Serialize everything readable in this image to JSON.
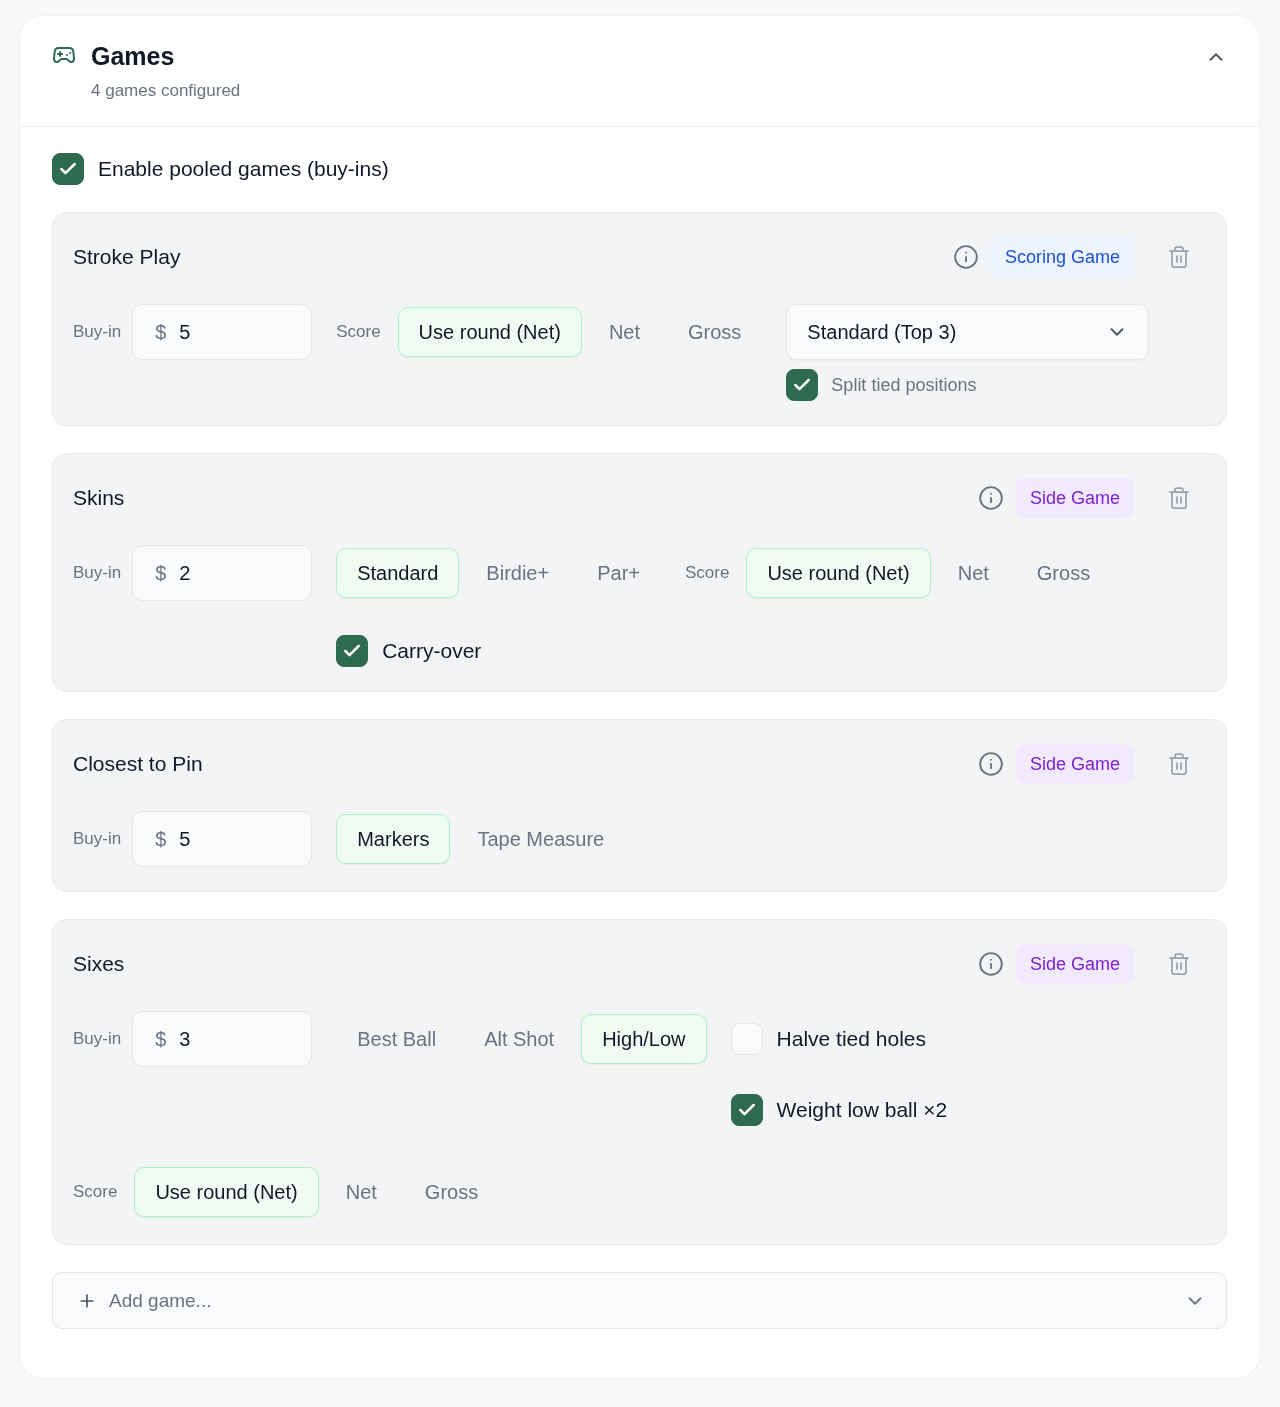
{
  "panel": {
    "title": "Games",
    "subtitle": "4 games configured",
    "expanded": true
  },
  "pooled": {
    "label": "Enable pooled games (buy-ins)",
    "checked": true
  },
  "games": [
    {
      "name": "Stroke Play",
      "tag": {
        "kind": "scoring",
        "label": "Scoring Game"
      },
      "controls": [
        {
          "kind": "buyin",
          "label": "Buy-in",
          "currency": "$",
          "value": "5"
        },
        {
          "kind": "choice",
          "label": "Score",
          "options": [
            {
              "label": "Use round (Net)",
              "selected": true
            },
            {
              "label": "Net",
              "selected": false
            },
            {
              "label": "Gross",
              "selected": false
            }
          ]
        },
        {
          "kind": "select",
          "value": "Standard (Top 3)",
          "option": {
            "label": "Split tied positions",
            "checked": true
          }
        }
      ]
    },
    {
      "name": "Skins",
      "tag": {
        "kind": "side",
        "label": "Side Game"
      },
      "controls": [
        {
          "kind": "buyin",
          "label": "Buy-in",
          "currency": "$",
          "value": "2"
        },
        {
          "kind": "choice",
          "options": [
            {
              "label": "Standard",
              "selected": true
            },
            {
              "label": "Birdie+",
              "selected": false
            },
            {
              "label": "Par+",
              "selected": false
            }
          ],
          "checkboxes": [
            {
              "label": "Carry-over",
              "checked": true
            }
          ]
        },
        {
          "kind": "choice",
          "label": "Score",
          "options": [
            {
              "label": "Use round (Net)",
              "selected": true
            },
            {
              "label": "Net",
              "selected": false
            },
            {
              "label": "Gross",
              "selected": false
            }
          ]
        }
      ]
    },
    {
      "name": "Closest to Pin",
      "tag": {
        "kind": "side",
        "label": "Side Game"
      },
      "controls": [
        {
          "kind": "buyin",
          "label": "Buy-in",
          "currency": "$",
          "value": "5"
        },
        {
          "kind": "choice",
          "options": [
            {
              "label": "Markers",
              "selected": true
            },
            {
              "label": "Tape Measure",
              "selected": false
            }
          ]
        }
      ]
    },
    {
      "name": "Sixes",
      "tag": {
        "kind": "side",
        "label": "Side Game"
      },
      "controls": [
        {
          "kind": "buyin",
          "label": "Buy-in",
          "currency": "$",
          "value": "3"
        },
        {
          "kind": "choice",
          "options": [
            {
              "label": "Best Ball",
              "selected": false
            },
            {
              "label": "Alt Shot",
              "selected": false
            },
            {
              "label": "High/Low",
              "selected": true
            }
          ]
        },
        {
          "kind": "checks",
          "checkboxes": [
            {
              "label": "Halve tied holes",
              "checked": false
            },
            {
              "label": "Weight low ball ×2",
              "checked": true
            }
          ]
        },
        {
          "kind": "choice",
          "label": "Score",
          "options": [
            {
              "label": "Use round (Net)",
              "selected": true
            },
            {
              "label": "Net",
              "selected": false
            },
            {
              "label": "Gross",
              "selected": false
            }
          ]
        }
      ]
    }
  ],
  "add_game": {
    "placeholder": "Add game..."
  }
}
